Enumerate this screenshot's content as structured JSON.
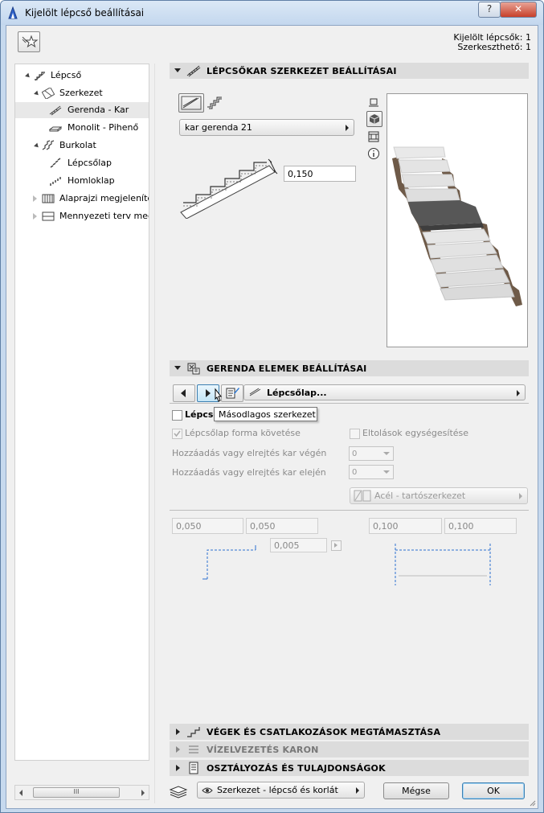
{
  "window": {
    "title": "Kijelölt lépcső beállításai",
    "help_label": "?",
    "close_label": "✕"
  },
  "selection_info": {
    "selected": "Kijelölt lépcsők: 1",
    "editable": "Szerkeszthető: 1"
  },
  "tree": {
    "items": [
      {
        "label": "Lépcső",
        "icon": "stair-icon"
      },
      {
        "label": "Szerkezet",
        "icon": "structure-icon"
      },
      {
        "label": "Gerenda - Kar",
        "icon": "beam-icon",
        "selected": true
      },
      {
        "label": "Monolit - Pihenő",
        "icon": "landing-icon"
      },
      {
        "label": "Burkolat",
        "icon": "finish-icon"
      },
      {
        "label": "Lépcsőlap",
        "icon": "tread-icon"
      },
      {
        "label": "Homloklap",
        "icon": "riser-icon"
      },
      {
        "label": "Alaprajzi megjelenítés",
        "icon": "floorplan-icon"
      },
      {
        "label": "Mennyezeti terv megjelenítés",
        "icon": "ceiling-icon"
      }
    ],
    "scroll_thumb": "III"
  },
  "section1": {
    "title": "LÉPCSŐKAR SZERKEZET BEÁLLÍTÁSAI",
    "type_dropdown": "kar gerenda 21",
    "thickness_value": "0,150"
  },
  "section2": {
    "title": "GERENDA ELEMEK BEÁLLÍTÁSAI",
    "element_dropdown": "Lépcsőlap...",
    "tooltip": "Másodlagos szerkezet",
    "checkbox_main": "Lépcsőlap",
    "checkbox_follow": "Lépcsőlap forma követése",
    "checkbox_offsets": "Eltolások egységesítése",
    "end_offset_label": "Hozzáadás vagy elrejtés kar végén",
    "start_offset_label": "Hozzáadás vagy elrejtés kar elején",
    "end_offset_value": "0",
    "start_offset_value": "0",
    "material_dropdown": "Acél - tartószerkezet",
    "left_val_1": "0,050",
    "left_val_2": "0,050",
    "right_val_1": "0,100",
    "right_val_2": "0,100",
    "center_val": "0,005"
  },
  "collapsed_sections": [
    {
      "title": "VÉGEK ÉS CSATLAKOZÁSOK MEGTÁMASZTÁSA",
      "dim": false
    },
    {
      "title": "VÍZELVEZETÉS KARON",
      "dim": true
    },
    {
      "title": "OSZTÁLYOZÁS ÉS TULAJDONSÁGOK",
      "dim": false
    }
  ],
  "bottom": {
    "layer_dropdown": "Szerkezet - lépcső és korlát",
    "cancel_label": "Mégse",
    "ok_label": "OK"
  },
  "colors": {
    "stair_wood": "#6e5a48",
    "tread": "#e4e4e4",
    "landing": "#575757",
    "accent": "#3c7fb1"
  }
}
